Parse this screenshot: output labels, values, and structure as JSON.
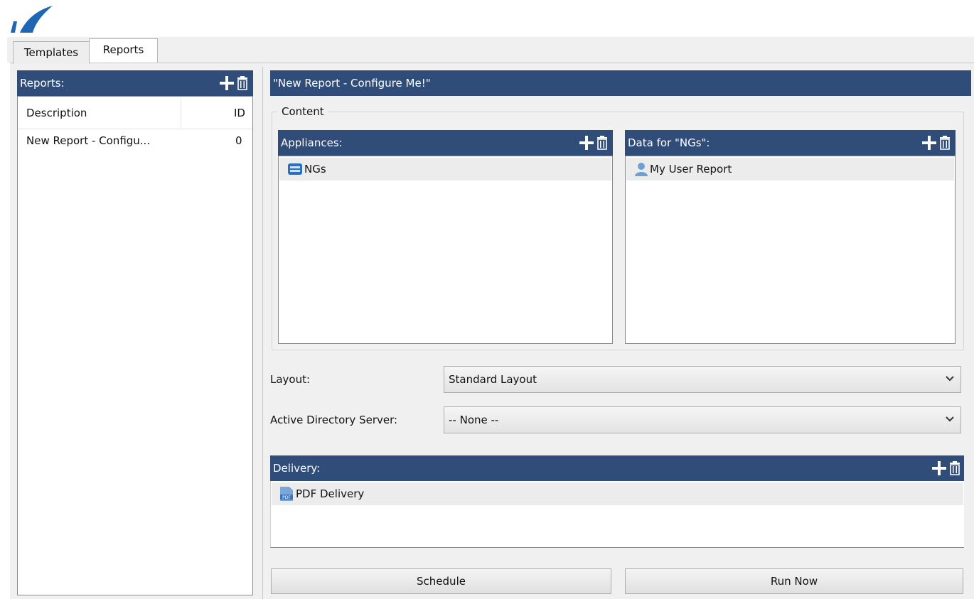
{
  "tabs": [
    {
      "label": "Templates"
    },
    {
      "label": "Reports"
    }
  ],
  "reports_panel": {
    "header": "Reports:",
    "columns": [
      "Description",
      "ID"
    ],
    "rows": [
      {
        "description": "New Report - Configu...",
        "id": "0"
      }
    ]
  },
  "report": {
    "title": "\"New Report - Configure Me!\"",
    "content_group_label": "Content",
    "appliances": {
      "header": "Appliances:",
      "items": [
        {
          "label": "NGs",
          "icon": "appliance-icon"
        }
      ]
    },
    "data_for": {
      "header": "Data for \"NGs\":",
      "items": [
        {
          "label": "My User Report",
          "icon": "user-icon"
        }
      ]
    },
    "layout": {
      "label": "Layout:",
      "value": "Standard Layout"
    },
    "ad_server": {
      "label": "Active Directory Server:",
      "value": "-- None --"
    },
    "delivery": {
      "header": "Delivery:",
      "items": [
        {
          "label": "PDF Delivery",
          "icon": "pdf-icon"
        }
      ]
    },
    "buttons": {
      "schedule": "Schedule",
      "run_now": "Run Now"
    }
  },
  "colors": {
    "header_bar": "#304d7a",
    "brand_logo": "#1f66b3"
  }
}
